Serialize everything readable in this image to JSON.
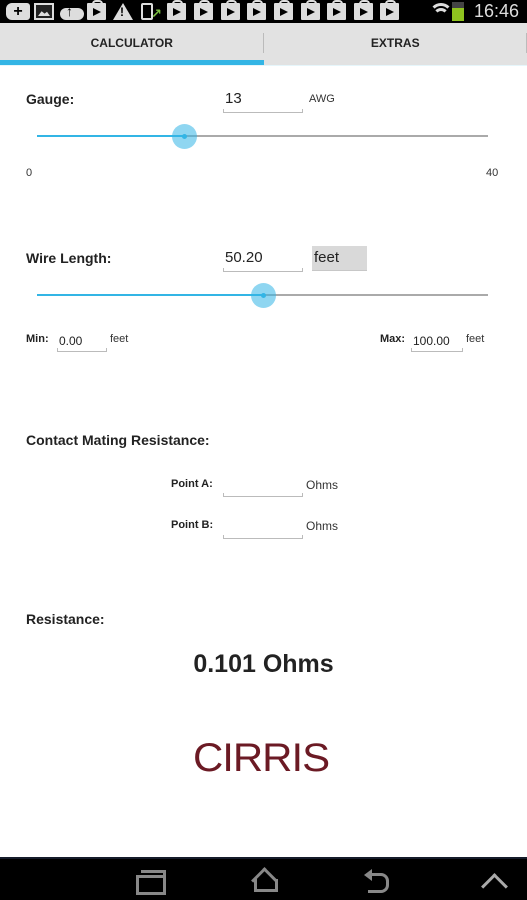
{
  "status_bar": {
    "time": "16:46",
    "notification_icons": [
      "add-icon",
      "image-icon",
      "cloud-upload-icon",
      "play-store-icon",
      "warning-icon",
      "phone-update-icon",
      "play-store-icon",
      "play-store-icon",
      "play-store-icon",
      "play-store-icon",
      "play-store-icon",
      "play-store-icon",
      "play-store-icon",
      "play-store-icon",
      "play-store-icon"
    ],
    "system_icons": [
      "wifi-icon",
      "battery-icon"
    ]
  },
  "tabs": [
    {
      "label": "CALCULATOR",
      "active": true
    },
    {
      "label": "EXTRAS",
      "active": false
    }
  ],
  "gauge": {
    "label": "Gauge:",
    "value": "13",
    "unit": "AWG",
    "slider": {
      "min": 0,
      "max": 40,
      "value": 13,
      "min_label": "0",
      "max_label": "40"
    }
  },
  "wire_length": {
    "label": "Wire Length:",
    "value": "50.20",
    "unit_button": "feet",
    "slider": {
      "min": 0,
      "max": 100,
      "value": 50.2
    },
    "min_label": "Min:",
    "min_value": "0.00",
    "min_unit": "feet",
    "max_label": "Max:",
    "max_value": "100.00",
    "max_unit": "feet"
  },
  "contact_mating": {
    "label": "Contact Mating Resistance:",
    "point_a_label": "Point A:",
    "point_a_value": "",
    "point_a_unit": "Ohms",
    "point_b_label": "Point B:",
    "point_b_value": "",
    "point_b_unit": "Ohms"
  },
  "resistance": {
    "label": "Resistance:",
    "value": "0.101 Ohms"
  },
  "logo": {
    "text": "CIRRIS",
    "color": "#6b1a24"
  },
  "colors": {
    "accent": "#33b5e5",
    "tab_bg": "#e2e2e2"
  },
  "nav_bar": [
    "recent-apps-icon",
    "home-icon",
    "back-icon",
    "chevron-up-icon"
  ]
}
